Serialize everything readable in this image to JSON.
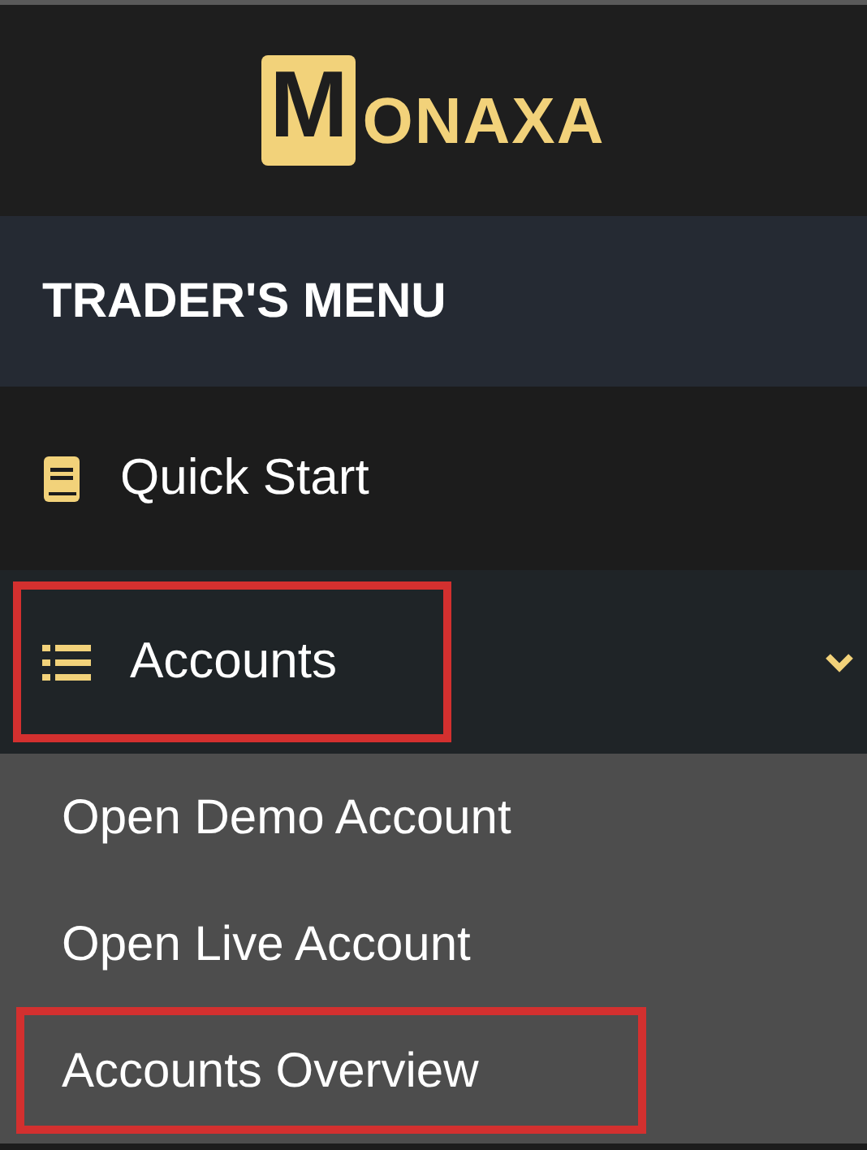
{
  "logo": {
    "mark": "M",
    "text": "ONAXA"
  },
  "menu_title": "TRADER'S MENU",
  "items": [
    {
      "label": "Quick Start",
      "kind": "book",
      "expanded": false,
      "highlighted": false
    },
    {
      "label": "Accounts",
      "kind": "list",
      "expanded": true,
      "highlighted": true,
      "children": [
        {
          "label": "Open Demo Account",
          "highlighted": false
        },
        {
          "label": "Open Live Account",
          "highlighted": false
        },
        {
          "label": "Accounts Overview",
          "highlighted": true
        }
      ]
    }
  ]
}
